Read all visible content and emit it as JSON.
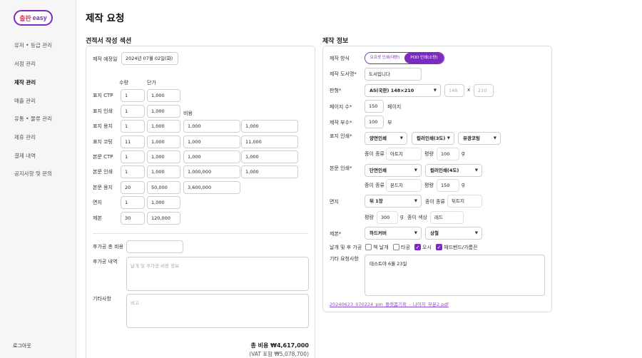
{
  "app": {
    "logo_part1": "출판",
    "logo_part2": "easy"
  },
  "sidebar": {
    "items": [
      {
        "label": "유저 • 등급 관리"
      },
      {
        "label": "서점 관리"
      },
      {
        "label": "제작 관리"
      },
      {
        "label": "매출 관리"
      },
      {
        "label": "유통 • 물류 관리"
      },
      {
        "label": "제휴 관리"
      },
      {
        "label": "결제 내역"
      },
      {
        "label": "공지사항 및 문의"
      }
    ],
    "logout": "로그아웃"
  },
  "page": {
    "title": "제작 요청"
  },
  "estimate": {
    "section_title": "견적서 작성 섹션",
    "date_label": "제작 예정일",
    "date_value": "2024년 07월 02일(화)",
    "col_qty": "수량",
    "col_unit": "단가",
    "col_cost": "비용",
    "rows": [
      {
        "label": "표지 CTP",
        "qty": "1",
        "unit": "1,000",
        "c1": "",
        "c2": ""
      },
      {
        "label": "표지 인쇄",
        "qty": "1",
        "unit": "1,000",
        "c1": "",
        "c2": ""
      },
      {
        "label": "표지 용지",
        "qty": "1",
        "unit": "1,000",
        "c1": "1,000",
        "c2": "1,000"
      },
      {
        "label": "표지 코팅",
        "qty": "11",
        "unit": "1,000",
        "c1": "1,000",
        "c2": "11,000"
      },
      {
        "label": "본문 CTP",
        "qty": "1",
        "unit": "1,000",
        "c1": "1,000",
        "c2": "1,000"
      },
      {
        "label": "본문 인쇄",
        "qty": "1",
        "unit": "1,000",
        "c1": "1,000,000",
        "c2": "1,000"
      },
      {
        "label": "본문 용지",
        "qty": "20",
        "unit": "50,000",
        "c1": "3,600,000",
        "c2": ""
      },
      {
        "label": "면지",
        "qty": "1",
        "unit": "1,000",
        "c1": "",
        "c2": ""
      },
      {
        "label": "제본",
        "qty": "30",
        "unit": "120,000",
        "c1": "",
        "c2": ""
      }
    ],
    "post_total_label": "후가공 총 비용",
    "post_total_value": "",
    "post_detail_label": "후가공 내역",
    "post_detail_placeholder": "날개 및 후가공 비용 정보",
    "etc_label": "기타사항",
    "etc_placeholder": "비고",
    "total": "총 비용 ₩4,617,000",
    "total_vat": "(VAT 포함 ₩5,078,700)"
  },
  "production": {
    "section_title": "제작 정보",
    "method_label": "제작 방식",
    "method_options": [
      "오프셋 인쇄(대량)",
      "POD 인쇄(소량)"
    ],
    "method_selected": "POD 인쇄(소량)",
    "bookname_label": "제작 도서명*",
    "bookname_value": "도서입니다",
    "size_label": "판형*",
    "size_value": "A5(국판) 148×210",
    "size_w_placeholder": "148",
    "size_x": "x",
    "size_h_placeholder": "210",
    "pages_label": "페이지 수*",
    "pages_value": "150",
    "pages_unit": "페이지",
    "copies_label": "제작 부수*",
    "copies_value": "100",
    "copies_unit": "부",
    "cover_label": "표지 인쇄*",
    "cover_side": "양면인쇄",
    "cover_color": "컬러인쇄(3도)",
    "cover_coat": "유광코팅",
    "paper_type_label": "종이 종류",
    "cover_paper": "아트지",
    "weight_label": "평량",
    "cover_weight": "100",
    "gram": "g",
    "body_label": "본문 인쇄*",
    "body_side": "단면인쇄",
    "body_color": "컬러인쇄(4도)",
    "body_paper": "본드지",
    "body_weight": "150",
    "endpaper_label": "면지",
    "endpaper_value": "뒤 1장",
    "endpaper_paper": "뒤트지",
    "endpaper_weight": "300",
    "paper_color_label": "종이 색상",
    "endpaper_color": "레드",
    "binding_label": "제본*",
    "binding_value": "하드커버",
    "binding_option": "상철",
    "finish_label": "날개 및 후 가공",
    "finish_options": [
      {
        "label": "책 날개",
        "checked": false
      },
      {
        "label": "타공",
        "checked": false
      },
      {
        "label": "오시",
        "checked": true
      },
      {
        "label": "헤드밴드/가름끈",
        "checked": true
      }
    ],
    "request_label": "기타 요청사항",
    "request_value": "테스트야 6월 23일",
    "attachment": "20240623_070224_pm_플랫폼기획_-_나이지_부분2.pdf"
  },
  "colors": {
    "accent": "#7b2cbf",
    "link": "#8a4fd0"
  }
}
